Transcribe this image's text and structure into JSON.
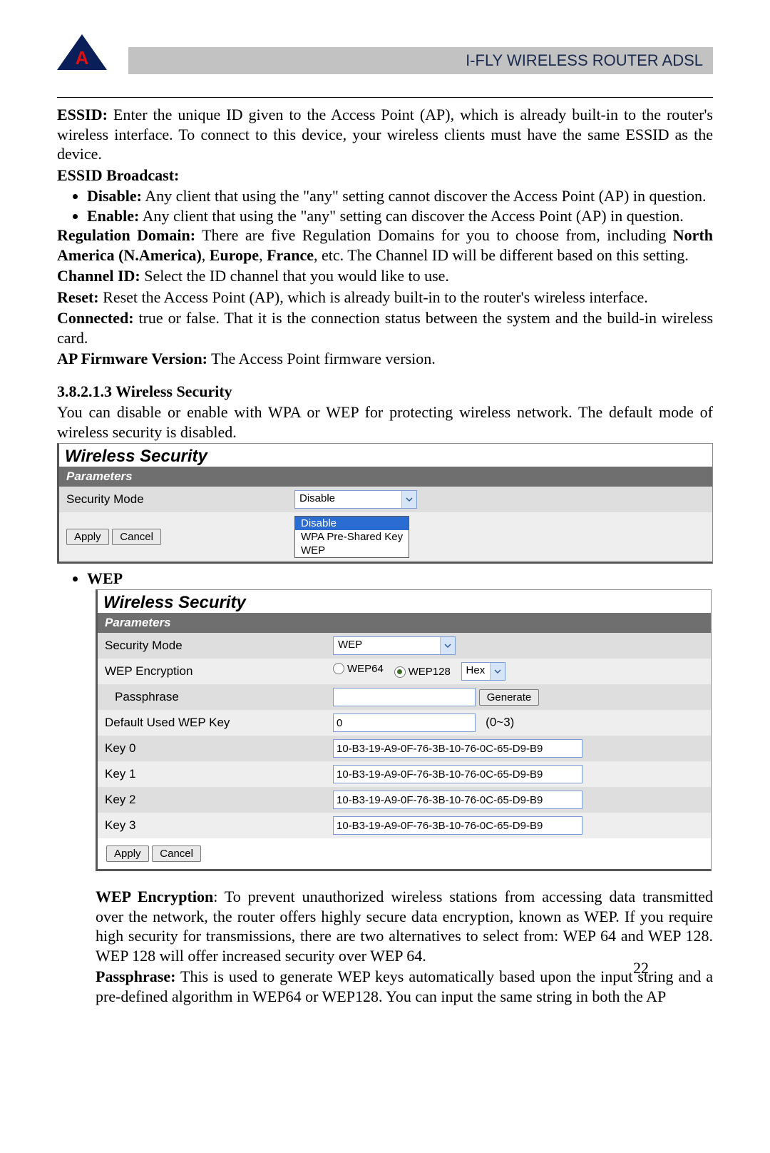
{
  "header": {
    "logo_letter": "A",
    "title": "I-FLY WIRELESS ROUTER ADSL"
  },
  "body": {
    "essid_label": "ESSID:",
    "essid_text": " Enter the unique ID given to the Access Point (AP), which is already built-in to the router's wireless interface. To connect to this device, your wireless clients must have the same ESSID as the device.",
    "essid_bc_label": "ESSID Broadcast:",
    "bc_disable_label": "Disable:",
    "bc_disable_text": " Any client that using the \"any\" setting cannot discover the Access Point (AP) in question.",
    "bc_enable_label": "Enable:",
    "bc_enable_text": " Any client that using the \"any\" setting can discover the Access Point (AP) in question.",
    "reg_label": "Regulation Domain:",
    "reg_text_a": " There are five Regulation Domains for you to choose from, including ",
    "reg_text_b": "North America (N.America)",
    "reg_text_c": ", ",
    "reg_text_d": "Europe",
    "reg_text_e": ", ",
    "reg_text_f": "France",
    "reg_text_g": ", etc. The Channel ID will be different based on this setting.",
    "chan_label": "Channel ID:",
    "chan_text": " Select the ID channel that you would like to use.",
    "reset_label": "Reset:",
    "reset_text": " Reset the Access Point (AP), which is already built-in to the router's wireless interface.",
    "conn_label": "Connected:",
    "conn_text": " true or false. That it is the connection status between the system and the build-in wireless card.",
    "fw_label": "AP Firmware Version:",
    "fw_text": " The Access Point firmware version.",
    "sec_heading": "3.8.2.1.3 Wireless Security",
    "sec_intro": "You can disable or enable with WPA or WEP for protecting wireless network. The default mode of wireless security is disabled."
  },
  "panel1": {
    "title": "Wireless Security",
    "params": "Parameters",
    "row_label": "Security Mode",
    "select_value": "Disable",
    "options": [
      "Disable",
      "WPA Pre-Shared Key",
      "WEP"
    ],
    "apply": "Apply",
    "cancel": "Cancel"
  },
  "wep_bullet": "WEP",
  "panel2": {
    "title": "Wireless Security",
    "params": "Parameters",
    "rows": {
      "mode_label": "Security Mode",
      "mode_value": "WEP",
      "enc_label": "WEP Encryption",
      "enc_radio1": "WEP64",
      "enc_radio2": "WEP128",
      "enc_format": "Hex",
      "pass_label": "Passphrase",
      "pass_value": "",
      "generate": "Generate",
      "defkey_label": "Default Used WEP Key",
      "defkey_value": "0",
      "defkey_range": "(0~3)",
      "k0l": "Key 0",
      "k0v": "10-B3-19-A9-0F-76-3B-10-76-0C-65-D9-B9",
      "k1l": "Key 1",
      "k1v": "10-B3-19-A9-0F-76-3B-10-76-0C-65-D9-B9",
      "k2l": "Key 2",
      "k2v": "10-B3-19-A9-0F-76-3B-10-76-0C-65-D9-B9",
      "k3l": "Key 3",
      "k3v": "10-B3-19-A9-0F-76-3B-10-76-0C-65-D9-B9"
    },
    "apply": "Apply",
    "cancel": "Cancel"
  },
  "after": {
    "wepenc_label": "WEP Encryption",
    "wepenc_text": ": To prevent unauthorized wireless stations from accessing data transmitted over the network, the router offers highly secure data encryption, known as WEP. If you require high security for transmissions, there are two alternatives to select from: WEP 64 and WEP 128. WEP 128 will offer increased security over WEP 64.",
    "pass_label": "Passphrase:",
    "pass_text": " This is used to generate WEP keys automatically based upon the input string and a pre-defined algorithm in WEP64 or WEP128. You can input the same string in both the AP"
  },
  "page_number": "22"
}
